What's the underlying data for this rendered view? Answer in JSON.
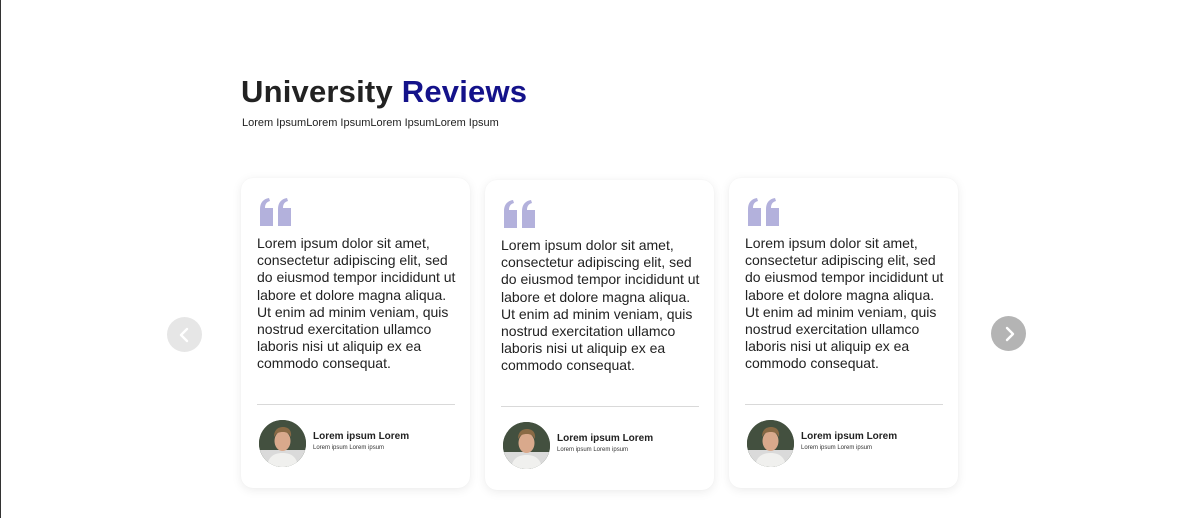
{
  "section": {
    "title_main": "University",
    "title_accent": "Reviews",
    "subtitle": "Lorem IpsumLorem IpsumLorem IpsumLorem Ipsum"
  },
  "colors": {
    "accent": "#14128a",
    "quote_icon": "#b3b1dc",
    "nav_prev": "#e6e6e6",
    "nav_next": "#b4b4b4"
  },
  "cards": [
    {
      "text": "Lorem ipsum dolor sit amet, consectetur adipiscing elit, sed do eiusmod tempor incididunt ut labore et dolore magna aliqua. Ut enim ad minim veniam, quis nostrud exercitation ullamco laboris nisi ut aliquip ex ea commodo consequat.",
      "author_name": "Lorem ipsum Lorem",
      "author_role": "Lorem ipsum Lorem ipsum"
    },
    {
      "text": "Lorem ipsum dolor sit amet, consectetur adipiscing elit, sed do eiusmod tempor incididunt ut labore et dolore magna aliqua. Ut enim ad minim veniam, quis nostrud exercitation ullamco laboris nisi ut aliquip ex ea commodo consequat.",
      "author_name": "Lorem ipsum Lorem",
      "author_role": "Lorem ipsum Lorem ipsum"
    },
    {
      "text": "Lorem ipsum dolor sit amet, consectetur adipiscing elit, sed do eiusmod tempor incididunt ut labore et dolore magna aliqua. Ut enim ad minim veniam, quis nostrud exercitation ullamco laboris nisi ut aliquip ex ea commodo consequat.",
      "author_name": "Lorem ipsum Lorem",
      "author_role": "Lorem ipsum Lorem ipsum"
    }
  ],
  "icons": {
    "quote": "quote-icon",
    "avatar": "avatar",
    "prev": "chevron-left-icon",
    "next": "chevron-right-icon"
  }
}
